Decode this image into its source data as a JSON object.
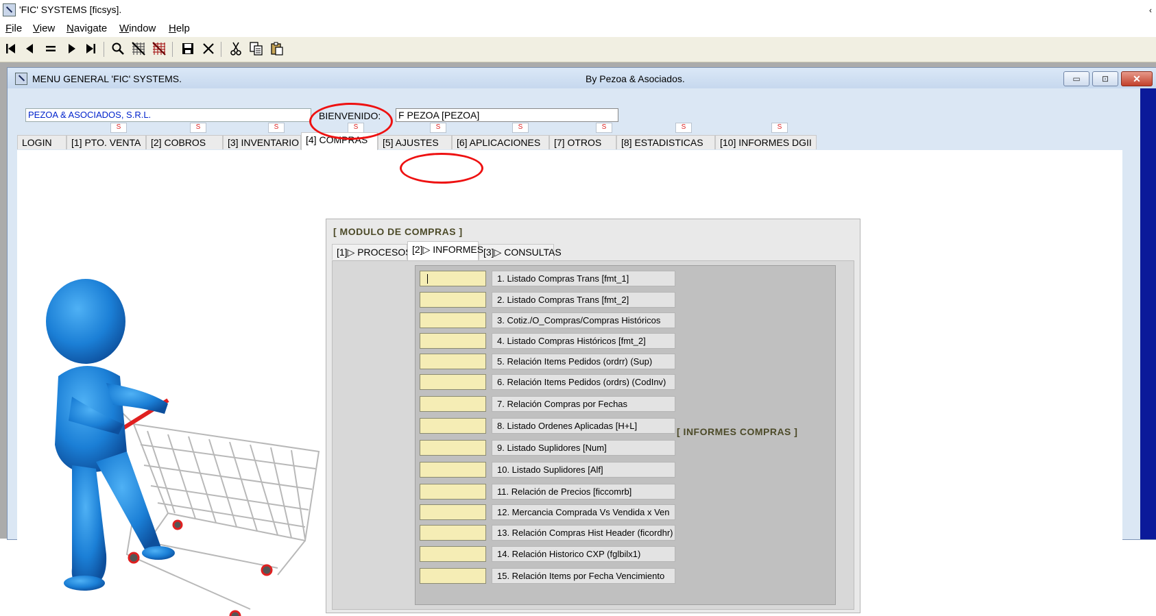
{
  "app": {
    "title": "'FIC' SYSTEMS [ficsys].",
    "caret": "‹"
  },
  "menu": {
    "items": [
      {
        "accel": "F",
        "rest": "ile"
      },
      {
        "accel": "V",
        "rest": "iew"
      },
      {
        "accel": "N",
        "rest": "avigate"
      },
      {
        "accel": "W",
        "rest": "indow"
      },
      {
        "accel": "H",
        "rest": "elp"
      }
    ]
  },
  "toolbar": {
    "icons": [
      "first-record-icon",
      "previous-record-icon",
      "equals-icon",
      "next-record-icon",
      "last-record-icon",
      "search-icon",
      "filter-icon",
      "filter-clear-icon",
      "save-icon",
      "delete-icon",
      "cut-icon",
      "copy-icon",
      "paste-icon"
    ]
  },
  "mdi": {
    "title": "MENU GENERAL 'FIC' SYSTEMS.",
    "byline": "By Pezoa & Asociados.",
    "minimize": "▭",
    "restore": "⊡",
    "close": "✕"
  },
  "header": {
    "company": "PEZOA & ASOCIADOS, S.R.L.",
    "welcome_label": "BIENVENIDO:",
    "welcome_value": "F PEZOA [PEZOA]",
    "marker": "S"
  },
  "main_tabs": [
    "LOGIN",
    "[1] PTO. VENTA",
    "[2]  COBROS",
    "[3]  INVENTARIO",
    "[4] COMPRAS",
    "[5] AJUSTES",
    "[6] APLICACIONES",
    "[7] OTROS",
    "[8] ESTADISTICAS",
    "[10] INFORMES DGII"
  ],
  "module": {
    "title": "[ MODULO DE  COMPRAS ]",
    "sub_tabs": [
      "[1]▷ PROCESOS",
      "[2]▷ INFORMES",
      "[3]▷ CONSULTAS"
    ],
    "section_label": "[ INFORMES COMPRAS ]",
    "reports": [
      "1. Listado Compras Trans [fmt_1]",
      "2. Listado Compras Trans [fmt_2]",
      "3. Cotiz./O_Compras/Compras Históricos",
      "4. Listado Compras Históricos [fmt_2]",
      "5. Relación Items Pedidos (ordrr) (Sup)",
      "6. Relación Items Pedidos (ordrs) (CodInv)",
      "7. Relación Compras por Fechas",
      "8. Listado Ordenes Aplicadas [H+L]",
      "9. Listado Suplidores [Num]",
      "10. Listado Suplidores [Alf]",
      "11. Relación de Precios [ficcomrb]",
      "12. Mercancia Comprada Vs Vendida x Ven",
      "13. Relación Compras Hist Header (ficordhr)",
      "14. Relación Historico CXP (fglbilx1)",
      "15. Relación Items por Fecha Vencimiento"
    ]
  }
}
